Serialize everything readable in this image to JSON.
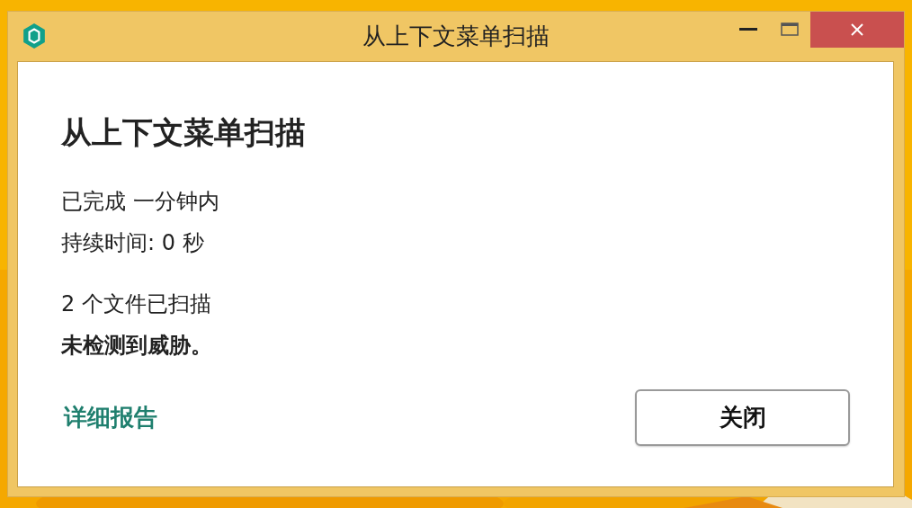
{
  "window": {
    "title": "从上下文菜单扫描"
  },
  "heading": "从上下文菜单扫描",
  "status_lines": [
    "已完成 一分钟内",
    "持续时间: 0 秒"
  ],
  "result_lines": [
    {
      "text": "2 个文件已扫描",
      "bold": false
    },
    {
      "text": "未检测到威胁。",
      "bold": true
    }
  ],
  "link": "详细报告",
  "button": "关闭"
}
